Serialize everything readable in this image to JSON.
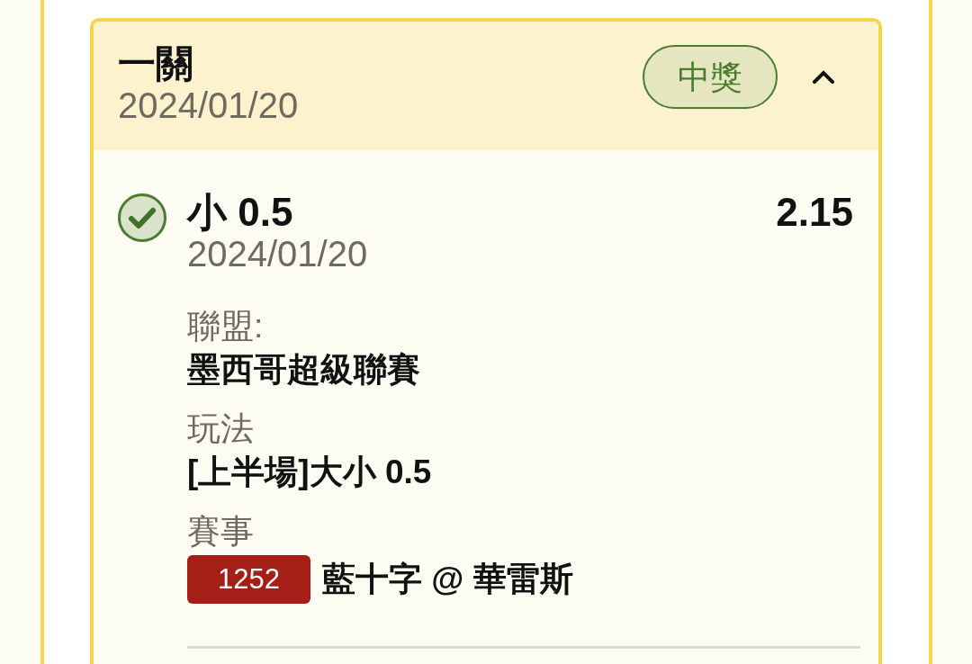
{
  "ticket": {
    "title": "一關",
    "date": "2024/01/20",
    "status": {
      "label": "中獎",
      "kind": "won"
    },
    "expanded": true,
    "selections": [
      {
        "won": true,
        "pick": "小 0.5",
        "odds": "2.15",
        "date": "2024/01/20",
        "details": [
          {
            "kind": "text",
            "label": "聯盟:",
            "value": "墨西哥超級聯賽"
          },
          {
            "kind": "text",
            "label": "玩法",
            "value": "[上半場]大小 0.5"
          },
          {
            "kind": "match",
            "label": "賽事",
            "match_code": "1252",
            "value": "藍十字 @ 華雷斯"
          }
        ]
      }
    ]
  }
}
